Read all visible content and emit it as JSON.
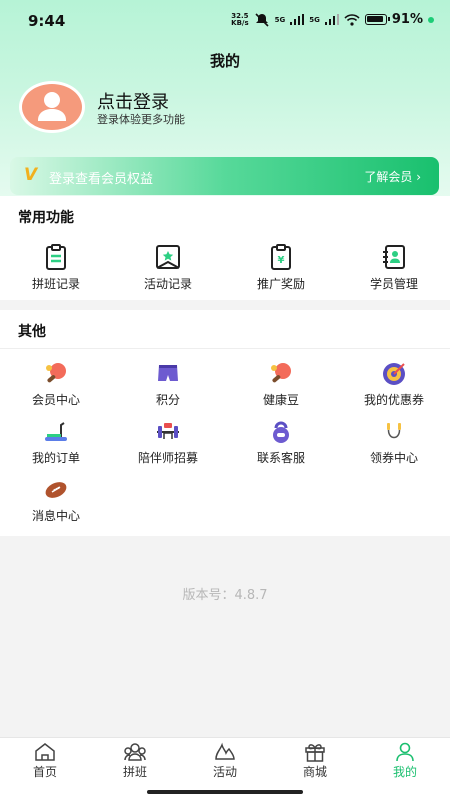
{
  "status_bar": {
    "time": "9:44",
    "speed_value": "32.5",
    "speed_unit": "KB/s",
    "net1": "5G",
    "net2": "5G",
    "battery": "91%"
  },
  "header": {
    "title": "我的"
  },
  "profile": {
    "login_title": "点击登录",
    "login_subtitle": "登录体验更多功能"
  },
  "vip": {
    "badge": "V",
    "text": "登录查看会员权益",
    "more": "了解会员 ›"
  },
  "common": {
    "title": "常用功能",
    "items": [
      {
        "label": "拼班记录",
        "icon": "clipboard-icon"
      },
      {
        "label": "活动记录",
        "icon": "star-badge-icon"
      },
      {
        "label": "推广奖励",
        "icon": "yen-clipboard-icon"
      },
      {
        "label": "学员管理",
        "icon": "contacts-book-icon"
      }
    ]
  },
  "other": {
    "title": "其他",
    "items": [
      {
        "label": "会员中心",
        "icon": "ping-pong-icon"
      },
      {
        "label": "积分",
        "icon": "shorts-icon"
      },
      {
        "label": "健康豆",
        "icon": "ping-pong-icon"
      },
      {
        "label": "我的优惠券",
        "icon": "target-icon"
      },
      {
        "label": "我的订单",
        "icon": "treadmill-icon"
      },
      {
        "label": "陪伴师招募",
        "icon": "barbell-icon"
      },
      {
        "label": "联系客服",
        "icon": "kettlebell-icon"
      },
      {
        "label": "领券中心",
        "icon": "jump-rope-icon"
      },
      {
        "label": "消息中心",
        "icon": "rugby-ball-icon"
      }
    ]
  },
  "version": "版本号：4.8.7",
  "tabs": [
    {
      "label": "首页",
      "icon": "home-icon"
    },
    {
      "label": "拼班",
      "icon": "group-icon"
    },
    {
      "label": "活动",
      "icon": "activity-icon"
    },
    {
      "label": "商城",
      "icon": "gift-icon"
    },
    {
      "label": "我的",
      "icon": "user-icon",
      "active": true
    }
  ],
  "colors": {
    "accent": "#1bbf6f",
    "avatar": "#f59a7c",
    "vip_badge": "#f2b01d"
  }
}
